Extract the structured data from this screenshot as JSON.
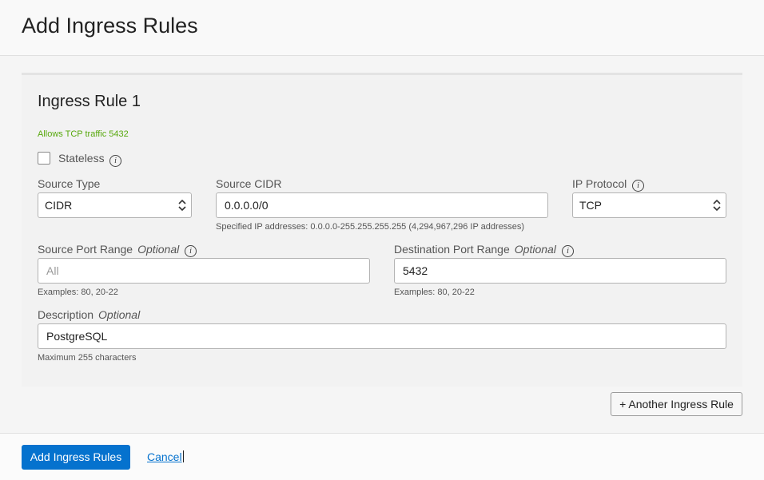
{
  "header": {
    "title": "Add Ingress Rules"
  },
  "rule": {
    "title": "Ingress Rule 1",
    "summary": "Allows TCP traffic 5432",
    "stateless_label": "Stateless",
    "stateless_checked": false,
    "source_type": {
      "label": "Source Type",
      "value": "CIDR"
    },
    "source_cidr": {
      "label": "Source CIDR",
      "value": "0.0.0.0/0",
      "help": "Specified IP addresses: 0.0.0.0-255.255.255.255 (4,294,967,296 IP addresses)"
    },
    "ip_protocol": {
      "label": "IP Protocol",
      "value": "TCP"
    },
    "source_port_range": {
      "label": "Source Port Range",
      "optional": "Optional",
      "placeholder": "All",
      "help": "Examples: 80, 20-22"
    },
    "destination_port_range": {
      "label": "Destination Port Range",
      "optional": "Optional",
      "value": "5432",
      "help": "Examples: 80, 20-22"
    },
    "description": {
      "label": "Description",
      "optional": "Optional",
      "value": "PostgreSQL",
      "help": "Maximum 255 characters"
    }
  },
  "another_rule_button": "+ Another Ingress Rule",
  "footer": {
    "primary_button": "Add Ingress Rules",
    "cancel_link": "Cancel"
  },
  "icons": {
    "info": "info-icon",
    "select_arrows": "updown-chevron-icon"
  },
  "colors": {
    "primary": "#0572ce",
    "summary_green": "#57a80c"
  }
}
